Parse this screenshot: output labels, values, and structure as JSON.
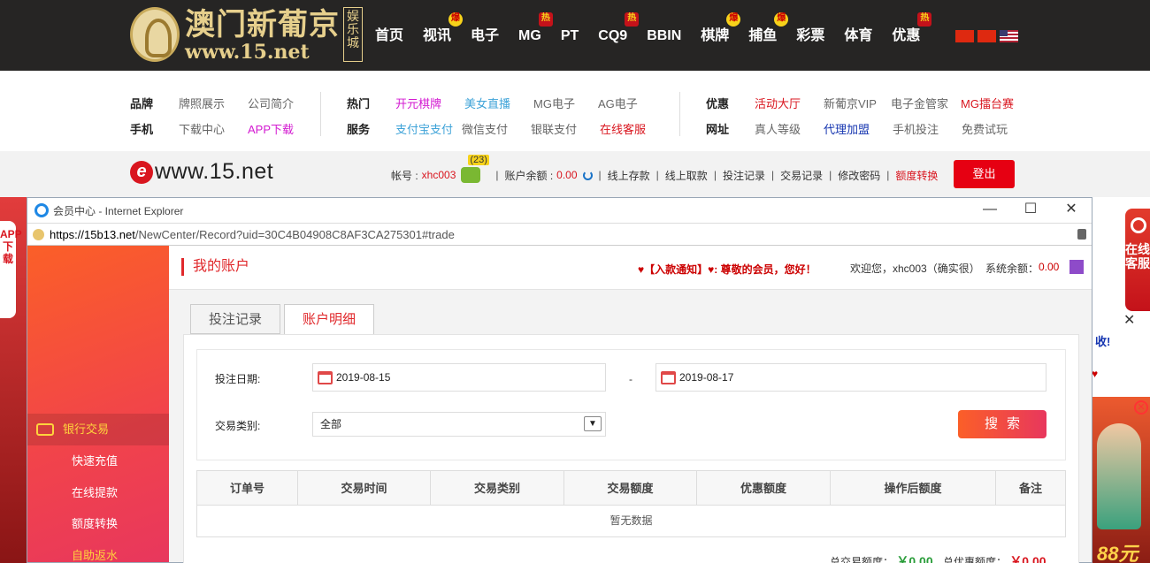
{
  "brand": {
    "name_cn": "澳门新葡京",
    "url": "www.15.net",
    "sub": "娱乐城"
  },
  "nav": {
    "items": [
      {
        "label": "首页",
        "badge": ""
      },
      {
        "label": "视讯",
        "badge": "爆"
      },
      {
        "label": "电子",
        "badge": ""
      },
      {
        "label": "MG",
        "badge": "热"
      },
      {
        "label": "PT",
        "badge": ""
      },
      {
        "label": "CQ9",
        "badge": "热"
      },
      {
        "label": "BBIN",
        "badge": ""
      },
      {
        "label": "棋牌",
        "badge": "爆"
      },
      {
        "label": "捕鱼",
        "badge": "爆"
      },
      {
        "label": "彩票",
        "badge": ""
      },
      {
        "label": "体育",
        "badge": ""
      },
      {
        "label": "优惠",
        "badge": "热"
      }
    ],
    "flags": [
      "cn-flag",
      "hk-flag",
      "us-flag"
    ]
  },
  "submenu": {
    "g1": {
      "row1_head": "品牌",
      "row1": [
        "牌照展示",
        "公司简介"
      ],
      "row2_head": "手机",
      "row2": [
        "下载中心",
        "APP下载"
      ]
    },
    "g2": {
      "row1_head": "热门",
      "row1": [
        "开元棋牌",
        "美女直播",
        "MG电子",
        "AG电子"
      ],
      "row2_head": "服务",
      "row2": [
        "支付宝支付",
        "微信支付",
        "银联支付",
        "在线客服"
      ]
    },
    "g3": {
      "row1_head": "优惠",
      "row1": [
        "活动大厅",
        "新葡京VIP",
        "电子金管家",
        "MG擂台赛"
      ],
      "row2_head": "网址",
      "row2": [
        "真人等级",
        "代理加盟",
        "手机投注",
        "免费试玩"
      ]
    }
  },
  "member": {
    "site_url": "www.15.net",
    "account_label": "帐号 :",
    "account": "xhc003",
    "msg_count": "(23)",
    "balance_label": "账户余额 :",
    "balance": "0.00",
    "links": [
      "线上存款",
      "线上取款",
      "投注记录",
      "交易记录",
      "修改密码"
    ],
    "transfer": "额度转换",
    "logout": "登出"
  },
  "side": {
    "left_tab": "APP下载",
    "right_kefu": "在线客服",
    "right_notice": "收!",
    "right_ad_yuan": "88元"
  },
  "ie": {
    "title": "会员中心 - Internet Explorer",
    "url_host": "https://15b13.net",
    "url_path": "/NewCenter/Record?uid=30C4B04908C8AF3CA275301#trade"
  },
  "sidenav": {
    "section": "银行交易",
    "items": [
      "快速充值",
      "在线提款",
      "额度转换",
      "自助返水"
    ]
  },
  "content": {
    "title": "我的账户",
    "notice": "♥【入款通知】♥: 尊敬的会员，您好！",
    "welcome": "欢迎您，xhc003（确实很）",
    "balance_label": "系统余额：",
    "balance": "0.00",
    "tabs": [
      "投注记录",
      "账户明细"
    ],
    "date_label": "投注日期:",
    "date_from": "2019-08-15",
    "date_sep": "-",
    "date_to": "2019-08-17",
    "type_label": "交易类别:",
    "type_value": "全部",
    "search": "搜索",
    "columns": [
      "订单号",
      "交易时间",
      "交易类别",
      "交易额度",
      "优惠额度",
      "操作后额度",
      "备注"
    ],
    "empty": "暂无数据",
    "total_trade_label": "总交易额度：",
    "total_trade": "￥0.00",
    "total_bonus_label": "总优惠额度：",
    "total_bonus": "￥0.00"
  }
}
